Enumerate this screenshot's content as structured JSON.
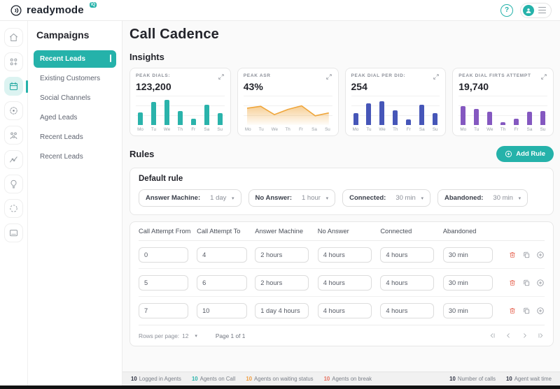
{
  "header": {
    "brand": "readymode",
    "brand_badge": "iQ",
    "icons": [
      "help-icon",
      "avatar",
      "menu-icon"
    ]
  },
  "sidebar": {
    "icons": [
      {
        "name": "home",
        "active": false
      },
      {
        "name": "apps",
        "active": false
      },
      {
        "name": "calendar",
        "active": true
      },
      {
        "name": "target",
        "active": false
      },
      {
        "name": "community",
        "active": false
      },
      {
        "name": "trending",
        "active": false
      },
      {
        "name": "lightbulb",
        "active": false
      },
      {
        "name": "spinner",
        "active": false
      },
      {
        "name": "monitor",
        "active": false
      }
    ]
  },
  "campaigns": {
    "title": "Campaigns",
    "items": [
      {
        "label": "Recent Leads",
        "active": true
      },
      {
        "label": "Existing Customers",
        "active": false
      },
      {
        "label": "Social Channels",
        "active": false
      },
      {
        "label": "Aged Leads",
        "active": false
      },
      {
        "label": "Recent Leads",
        "active": false
      },
      {
        "label": "Recent Leads",
        "active": false
      }
    ]
  },
  "main": {
    "title": "Call Cadence",
    "insights_title": "Insights",
    "rules_title": "Rules",
    "add_rule_label": "Add Rule"
  },
  "chart_data": [
    {
      "type": "bar",
      "title": "PEAK DIALS:",
      "display_value": "123,200",
      "categories": [
        "Mo",
        "Tu",
        "We",
        "Th",
        "Fr",
        "Sa",
        "Su"
      ],
      "values": [
        42,
        78,
        85,
        48,
        22,
        70,
        40
      ],
      "ylim": [
        0,
        100
      ],
      "color": "#2ab3ab",
      "note": "values are relative bar heights in % of chart area; no y-axis labels shown"
    },
    {
      "type": "area",
      "title": "PEAK ASR",
      "display_value": "43%",
      "categories": [
        "Mo",
        "Tu",
        "We",
        "Th",
        "Fr",
        "Sa",
        "Su"
      ],
      "values": [
        62,
        70,
        35,
        57,
        72,
        30,
        42
      ],
      "ylim": [
        0,
        100
      ],
      "color": "#efa63c",
      "note": "values are relative line heights in % of chart area; no y-axis labels shown"
    },
    {
      "type": "bar",
      "title": "PEAK DIAL PER DID:",
      "display_value": "254",
      "categories": [
        "Mo",
        "Tu",
        "We",
        "Th",
        "Fr",
        "Sa",
        "Su"
      ],
      "values": [
        40,
        75,
        82,
        50,
        20,
        68,
        40
      ],
      "ylim": [
        0,
        100
      ],
      "color": "#4656b8",
      "note": "values are relative bar heights in % of chart area; no y-axis labels shown"
    },
    {
      "type": "bar",
      "title": "PEAK DIAL FIRTS ATTEMPT",
      "display_value": "19,740",
      "categories": [
        "Mo",
        "Tu",
        "We",
        "Th",
        "Fr",
        "Sa",
        "Su"
      ],
      "values": [
        65,
        55,
        45,
        10,
        22,
        45,
        47
      ],
      "ylim": [
        0,
        100
      ],
      "color": "#8458c0",
      "note": "values are relative bar heights in % of chart area; no y-axis labels shown"
    }
  ],
  "default_rule": {
    "title": "Default rule",
    "fields": [
      {
        "label": "Answer Machine:",
        "value": "1 day"
      },
      {
        "label": "No Answer:",
        "value": "1 hour"
      },
      {
        "label": "Connected:",
        "value": "30 min"
      },
      {
        "label": "Abandoned:",
        "value": "30 min"
      }
    ]
  },
  "rules_table": {
    "columns": [
      "Call Attempt From",
      "Call Attempt To",
      "Answer Machine",
      "No Answer",
      "Connected",
      "Abandoned"
    ],
    "rows": [
      [
        "0",
        "4",
        "2 hours",
        "4 hours",
        "4 hours",
        "30 min"
      ],
      [
        "5",
        "6",
        "2 hours",
        "4 hours",
        "4 hours",
        "30 min"
      ],
      [
        "7",
        "10",
        "1 day 4 hours",
        "4 hours",
        "4 hours",
        "30 min"
      ]
    ],
    "row_actions": [
      "delete-icon",
      "duplicate-icon",
      "add-icon"
    ],
    "footer": {
      "rows_per_page_label": "Rows per page:",
      "rows_per_page_value": "12",
      "page_info": "Page 1 of 1",
      "pager_icons": [
        "first-page-icon",
        "prev-page-icon",
        "next-page-icon",
        "last-page-icon"
      ]
    }
  },
  "status_bar": {
    "left_items": [
      {
        "value": "10",
        "label": "Logged in Agents",
        "color": "#2d3142"
      },
      {
        "value": "10",
        "label": "Agents on Call",
        "color": "#2ab3ab"
      },
      {
        "value": "10",
        "label": "Agents on waiting status",
        "color": "#f09d3f"
      },
      {
        "value": "10",
        "label": "Agents on break",
        "color": "#e8705f"
      }
    ],
    "right_items": [
      {
        "value": "10",
        "label": "Number of calls",
        "color": "#2d3142"
      },
      {
        "value": "10",
        "label": "Agent wait time",
        "color": "#2d3142"
      }
    ]
  },
  "colors": {
    "accent_teal": "#25b2aa",
    "active_item_bg": "#dcf3f1",
    "danger": "#e8705f",
    "main_bg": "#fafafa",
    "border": "#e7e7e7"
  }
}
